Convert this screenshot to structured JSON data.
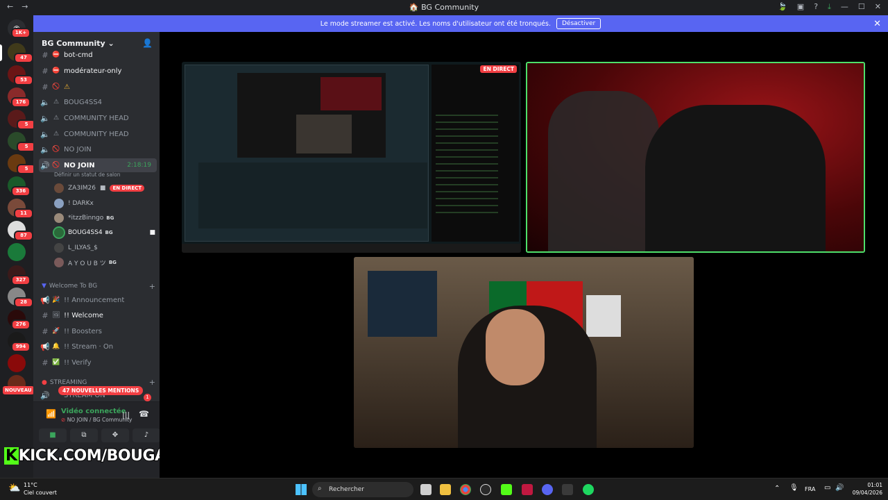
{
  "window": {
    "title": "BG Community"
  },
  "banner": {
    "text": "Le mode streamer est activé. Les noms d'utilisateur ont été tronqués.",
    "button": "Désactiver"
  },
  "server": {
    "name": "BG Community"
  },
  "server_badges": [
    "1K+",
    "47",
    "53",
    "176",
    "5",
    "5",
    "5",
    "336",
    "11",
    "87",
    "327",
    "28",
    "276",
    "994"
  ],
  "channels": [
    {
      "name": "bot-cmd",
      "emoji": "⛔"
    },
    {
      "name": "modérateur-only",
      "emoji": "⛔"
    },
    {
      "name": "⚠",
      "emoji": "🚫"
    },
    {
      "name": "BOUG4SS4",
      "emoji": "⚠"
    },
    {
      "name": "COMMUNITY HEAD",
      "emoji": "⚠"
    },
    {
      "name": "COMMUNITY HEAD",
      "emoji": "⚠"
    },
    {
      "name": "NO JOIN",
      "emoji": "🚫"
    },
    {
      "name": "NO JOIN",
      "emoji": "🚫",
      "time": "2:18:19",
      "status": "Définir un statut de salon"
    }
  ],
  "voice_users": [
    {
      "name": "ZA3IM26",
      "live": "EN DIRECT"
    },
    {
      "name": "! DARKx"
    },
    {
      "name": "*itzzBinngo",
      "tag": "BG"
    },
    {
      "name": "BOUG4SS4",
      "tag": "BG"
    },
    {
      "name": "L_ILYAS_$"
    },
    {
      "name": "A Y O U B ツ",
      "tag": "BG"
    }
  ],
  "category_welcome": "Welcome To BG",
  "welcome_channels": [
    {
      "name": "!! Announcement"
    },
    {
      "name": "!! Welcome"
    },
    {
      "name": "!! Boosters"
    },
    {
      "name": "!! Stream · On"
    },
    {
      "name": "!! Verify"
    }
  ],
  "category_streaming": "STREAMING",
  "streaming_channel": "STREAM ON",
  "mentions": "47 NOUVELLES MENTIONS",
  "nouveau": "NOUVEAU",
  "voice": {
    "title": "Vidéo connectée",
    "sub": "NO JOIN / BG Community"
  },
  "overlay": {
    "kick": "KICK.COM/BOUGASSAA"
  },
  "stream_badge": "EN DIRECT",
  "taskbar": {
    "temp": "11°C",
    "weather": "Ciel couvert",
    "search": "Rechercher",
    "lang": "FRA",
    "time": "01:01",
    "date": "09/04/2026"
  },
  "colors": {
    "accent": "#5865f2",
    "live": "#f23f43",
    "speaking": "#4ee06a"
  }
}
